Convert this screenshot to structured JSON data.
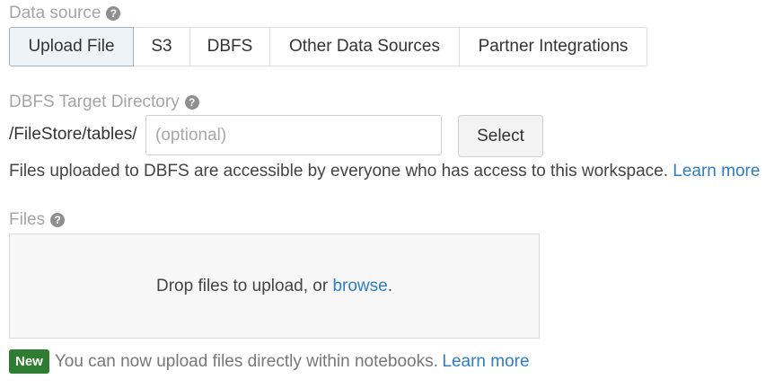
{
  "data_source": {
    "label": "Data source",
    "tabs": [
      {
        "label": "Upload File",
        "active": true
      },
      {
        "label": "S3",
        "active": false
      },
      {
        "label": "DBFS",
        "active": false
      },
      {
        "label": "Other Data Sources",
        "active": false
      },
      {
        "label": "Partner Integrations",
        "active": false
      }
    ]
  },
  "target_directory": {
    "label": "DBFS Target Directory",
    "path_prefix": "/FileStore/tables/",
    "input_value": "",
    "input_placeholder": "(optional)",
    "select_button": "Select"
  },
  "info": {
    "text": "Files uploaded to DBFS are accessible by everyone who has access to this workspace.",
    "link": "Learn more"
  },
  "files": {
    "label": "Files",
    "dropzone_text": "Drop files to upload, or",
    "browse_link": "browse",
    "dropzone_suffix": "."
  },
  "notice": {
    "badge": "New",
    "text": "You can now upload files directly within notebooks.",
    "link": "Learn more"
  },
  "icons": {
    "help": "question-circle-icon"
  },
  "colors": {
    "link": "#2d7ec4",
    "badge": "#2e7d32",
    "label": "#a4a4a4"
  }
}
